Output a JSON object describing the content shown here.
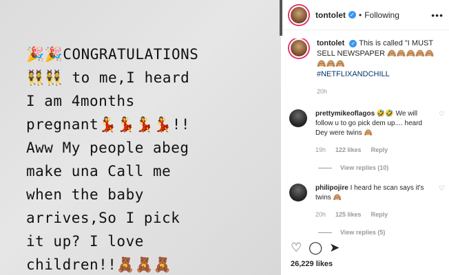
{
  "post": {
    "image_text": "🎉🎉CONGRATULATIONS\n👯👯 to me,I heard\nI am 4months\npregnant💃💃💃💃!!\nAww My people abeg\nmake una Call me\nwhen the baby\narrives,So I pick\nit up? I love\nchildren!!🧸🧸🧸"
  },
  "header": {
    "username": "tontolet",
    "separator": "•",
    "follow_label": "Following",
    "more_label": "•••"
  },
  "caption": {
    "username": "tontolet",
    "text": "This is called \"I MUST SELL NEWSPAPER 🙈🙈🙈🙈🙈🙈🙈🙈",
    "hashtag": "#NETFLIXANDCHILL",
    "time": "20h"
  },
  "comments": [
    {
      "username": "prettymikeoflagos",
      "text": "🤣🤣 We will follow u to go pick dem up.... heard Dey were twins 🙈",
      "time": "19h",
      "likes": "122 likes",
      "reply_label": "Reply",
      "view_replies": "View replies (10)"
    },
    {
      "username": "philipojire",
      "text": "I heard he scan says it's twins 🙈",
      "time": "20h",
      "likes": "125 likes",
      "reply_label": "Reply",
      "view_replies": "View replies (5)"
    }
  ],
  "actions": {
    "like_icon": "♡",
    "comment_icon": "◯",
    "share_icon": "➤"
  },
  "likes_count": "26,229 likes"
}
